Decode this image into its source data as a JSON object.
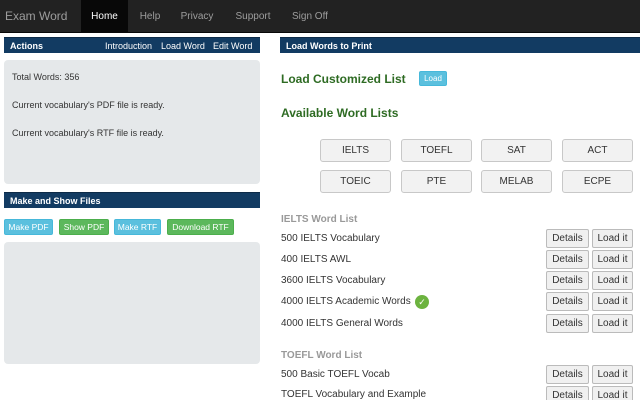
{
  "app": {
    "title": "Exam Word"
  },
  "nav": {
    "items": [
      "Home",
      "Help",
      "Privacy",
      "Support",
      "Sign Off"
    ],
    "active": "Home"
  },
  "actions": {
    "title": "Actions",
    "links": [
      "Introduction",
      "Load Word",
      "Edit Word"
    ],
    "total_words": "Total Words: 356",
    "pdf_status": "Current vocabulary's PDF file is ready.",
    "rtf_status": "Current vocabulary's RTF file is ready."
  },
  "make_show": {
    "title": "Make and Show Files",
    "buttons": [
      "Make PDF",
      "Show PDF",
      "Make RTF",
      "Download RTF"
    ]
  },
  "load_words": {
    "title": "Load Words to Print",
    "customized_label": "Load Customized List",
    "load_button": "Load",
    "available_label": "Available Word Lists",
    "word_lists": [
      "IELTS",
      "TOEFL",
      "SAT",
      "ACT",
      "TOEIC",
      "PTE",
      "MELAB",
      "ECPE"
    ]
  },
  "ielts": {
    "title": "IELTS Word List",
    "rows": [
      "500 IELTS Vocabulary",
      "400 IELTS AWL",
      "3600 IELTS Vocabulary",
      "4000 IELTS Academic Words",
      "4000 IELTS General Words"
    ]
  },
  "toefl": {
    "title": "TOEFL Word List",
    "rows": [
      "500 Basic TOEFL Vocab",
      "TOEFL Vocabulary and Example"
    ]
  },
  "row_buttons": {
    "details": "Details",
    "load_it": "Load it"
  },
  "icons": {
    "loaded": "check-circle-icon"
  },
  "colors": {
    "nav_bg": "#222222",
    "header_bar": "#123b62",
    "info": "#5bc0de",
    "success": "#5cb85c",
    "heading_green": "#2e6b23",
    "check": "#6cb33f"
  }
}
